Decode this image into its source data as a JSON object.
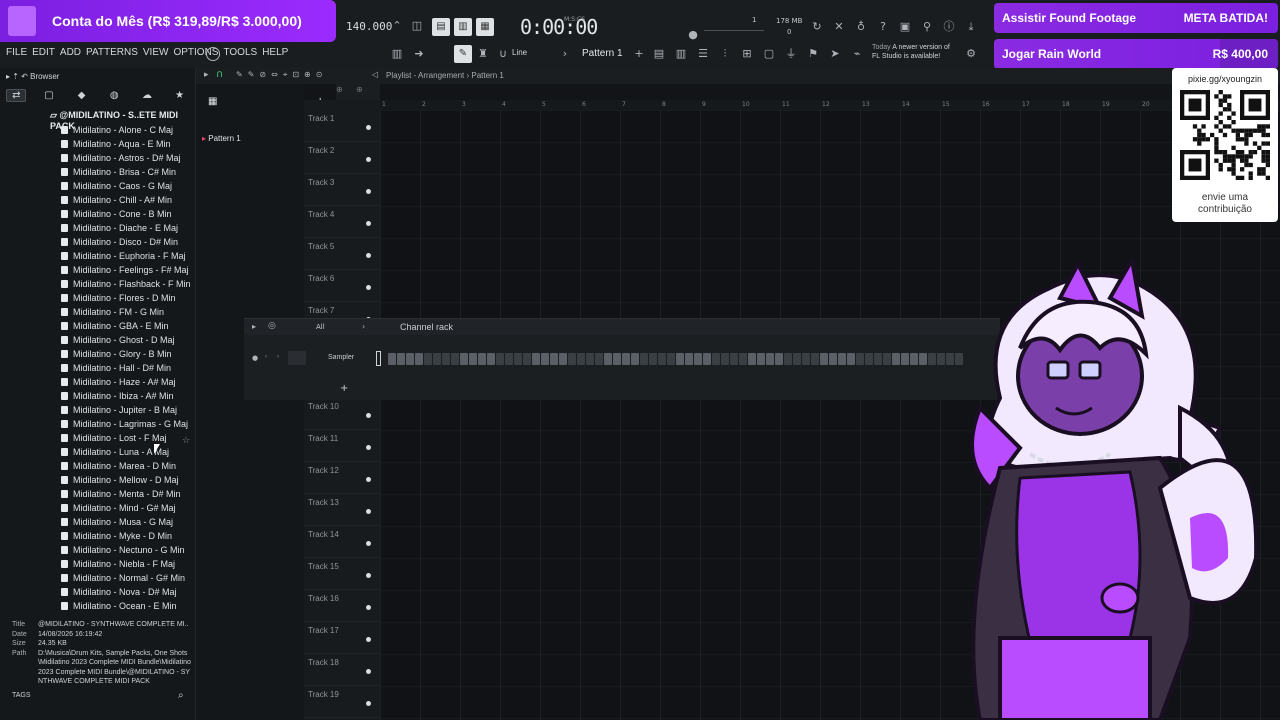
{
  "stream": {
    "goal_left": "Conta do Mês (R$ 319,89/R$ 3.000,00)",
    "goal_right_1": {
      "label": "Assistir Found Footage",
      "status": "META BATIDA!"
    },
    "goal_right_2": {
      "label": "Jogar Rain World",
      "amount": "R$ 400,00"
    },
    "qr_url": "pixie.gg/xyoungzin",
    "qr_caption_1": "envie uma",
    "qr_caption_2": "contribuição",
    "accent": "#8a2be2"
  },
  "menu": [
    "FILE",
    "EDIT",
    "ADD",
    "PATTERNS",
    "VIEW",
    "OPTIONS",
    "TOOLS",
    "HELP"
  ],
  "transport": {
    "tempo": "140.000",
    "time": "0:00:00",
    "time_unit": "M:S:CS",
    "memory": "178 MB",
    "memory_value": "0",
    "cpu_value": "1"
  },
  "toolbar": {
    "pattern": "Pattern 1",
    "snap": "Line",
    "news_date": "Today",
    "news_line1": "A newer version of",
    "news_line2": "FL Studio is available!"
  },
  "browser": {
    "title": "Browser",
    "folder": "@MIDILATINO - S..ETE MIDI PACK",
    "files": [
      "Midilatino - Alone - C Maj",
      "Midilatino - Aqua - E Min",
      "Midilatino - Astros - D# Maj",
      "Midilatino - Brisa - C# Min",
      "Midilatino - Caos - G Maj",
      "Midilatino - Chill - A# Min",
      "Midilatino - Cone - B Min",
      "Midilatino - Diache - E Maj",
      "Midilatino - Disco - D# Min",
      "Midilatino - Euphoria - F Maj",
      "Midilatino - Feelings - F# Maj",
      "Midilatino - Flashback - F Min",
      "Midilatino - Flores - D Min",
      "Midilatino - FM - G Min",
      "Midilatino - GBA - E Min",
      "Midilatino - Ghost - D Maj",
      "Midilatino - Glory - B Min",
      "Midilatino - Hall - D# Min",
      "Midilatino - Haze - A# Maj",
      "Midilatino - Ibiza - A# Min",
      "Midilatino - Jupiter - B Maj",
      "Midilatino - Lagrimas - G Maj",
      "Midilatino - Lost - F Maj",
      "Midilatino - Luna - A Maj",
      "Midilatino - Marea - D Min",
      "Midilatino - Mellow - D Maj",
      "Midilatino - Menta - D# Min",
      "Midilatino - Mind - G# Maj",
      "Midilatino - Musa - G Maj",
      "Midilatino - Myke - D Min",
      "Midilatino - Nectuno - G Min",
      "Midilatino - Niebla - F Maj",
      "Midilatino - Normal - G# Min",
      "Midilatino - Nova - D# Maj",
      "Midilatino - Ocean - E Min"
    ],
    "info": {
      "title_label": "Title",
      "title": "@MIDILATINO - SYNTHWAVE COMPLETE MI..",
      "date_label": "Date",
      "date": "14/08/2026 16:19:42",
      "size_label": "Size",
      "size": "24.35 KB",
      "path_label": "Path",
      "path": "D:\\Musica\\Drum Kits, Sample Packs, One Shots\\Midilatino 2023 Complete MIDI Bundle\\Midilatino 2023 Complete MIDI Bundle\\@MIDILATINO - SYNTHWAVE COMPLETE MIDI PACK"
    },
    "tags": "TAGS"
  },
  "playlist": {
    "title": "Playlist - Arrangement › Pattern 1",
    "pattern_item": "Pattern 1",
    "ruler": [
      "1",
      "2",
      "3",
      "4",
      "5",
      "6",
      "7",
      "8",
      "9",
      "10",
      "11",
      "12",
      "13",
      "14",
      "15",
      "16",
      "17",
      "18",
      "19",
      "20"
    ],
    "tracks_top": [
      "Track 1",
      "Track 2",
      "Track 3",
      "Track 4",
      "Track 5",
      "Track 6",
      "Track 7"
    ],
    "tracks_bottom": [
      "Track 10",
      "Track 11",
      "Track 12",
      "Track 13",
      "Track 14",
      "Track 15",
      "Track 16",
      "Track 17",
      "Track 18",
      "Track 19"
    ]
  },
  "channel_rack": {
    "filter": "All",
    "title": "Channel rack",
    "channel": "Sampler",
    "add": "+"
  }
}
